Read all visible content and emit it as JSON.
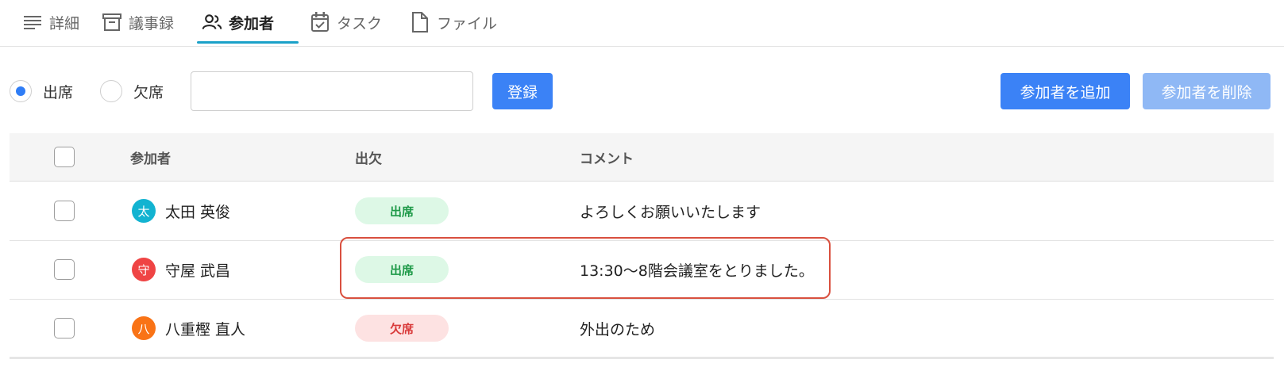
{
  "tabs": [
    {
      "label": "詳細",
      "icon": "list-icon"
    },
    {
      "label": "議事録",
      "icon": "archive-icon"
    },
    {
      "label": "参加者",
      "icon": "people-icon",
      "active": true
    },
    {
      "label": "タスク",
      "icon": "calendar-check-icon"
    },
    {
      "label": "ファイル",
      "icon": "file-icon"
    }
  ],
  "toolbar": {
    "radio_present": "出席",
    "radio_absent": "欠席",
    "selected": "出席",
    "comment_value": "",
    "comment_placeholder": "",
    "register_label": "登録",
    "add_label": "参加者を追加",
    "delete_label": "参加者を削除"
  },
  "table": {
    "headers": {
      "participant": "参加者",
      "attendance": "出欠",
      "comment": "コメント"
    },
    "rows": [
      {
        "initial": "太",
        "avatar_color": "#12b3d1",
        "name": "太田 英俊",
        "status": "出席",
        "status_type": "present",
        "comment": "よろしくお願いいたします"
      },
      {
        "initial": "守",
        "avatar_color": "#ef4444",
        "name": "守屋 武昌",
        "status": "出席",
        "status_type": "present",
        "comment": "13:30～8階会議室をとりました。"
      },
      {
        "initial": "八",
        "avatar_color": "#f97316",
        "name": "八重樫 直人",
        "status": "欠席",
        "status_type": "absent",
        "comment": "外出のため"
      }
    ]
  },
  "colors": {
    "accent": "#3b82f6",
    "tab_underline": "#1aa1c8",
    "highlight": "#d9503f"
  }
}
